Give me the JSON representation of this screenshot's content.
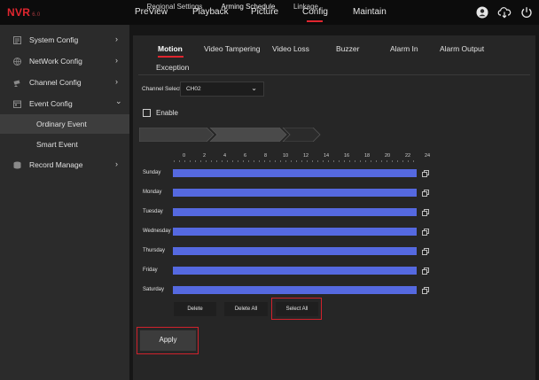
{
  "app": {
    "logo": "NVR",
    "logo_sub": "6.0"
  },
  "topnav": {
    "tabs": [
      "PreView",
      "Playback",
      "Picture",
      "Config",
      "Maintain"
    ],
    "active": "Config"
  },
  "sidebar": {
    "items": [
      {
        "label": "System Config",
        "arrow": "›"
      },
      {
        "label": "NetWork Config",
        "arrow": "›"
      },
      {
        "label": "Channel Config",
        "arrow": "›"
      },
      {
        "label": "Event Config",
        "arrow": "⌄"
      },
      {
        "label": "Record Manage",
        "arrow": "›"
      }
    ],
    "subitems": [
      "Ordinary Event",
      "Smart Event"
    ],
    "active_sub": "Ordinary Event"
  },
  "tabs": {
    "row1": [
      "Motion",
      "Video Tampering",
      "Video Loss",
      "Buzzer",
      "Alarm In",
      "Alarm Output"
    ],
    "row2": [
      "Exception"
    ],
    "active": "Motion"
  },
  "channel": {
    "label": "Channel Select",
    "value": "CH02"
  },
  "enable": {
    "label": "Enable",
    "checked": false
  },
  "crumbs": [
    "Regional Settings",
    "Arming Schedule",
    "Linkage"
  ],
  "active_crumb": "Arming Schedule",
  "schedule": {
    "hours": [
      "0",
      "2",
      "4",
      "6",
      "8",
      "10",
      "12",
      "14",
      "16",
      "18",
      "20",
      "22",
      "24"
    ],
    "days": [
      "Sunday",
      "Monday",
      "Tuesday",
      "Wednesday",
      "Thursday",
      "Friday",
      "Saturday"
    ],
    "coverage": [
      1,
      1,
      1,
      1,
      1,
      1,
      1
    ]
  },
  "buttons": {
    "delete": "Delete",
    "delete_all": "Delete All",
    "select_all": "Select All",
    "apply": "Apply"
  },
  "colors": {
    "accent": "#e0262f",
    "schedule_bar": "#5569e0",
    "highlight": "#d0222c"
  }
}
